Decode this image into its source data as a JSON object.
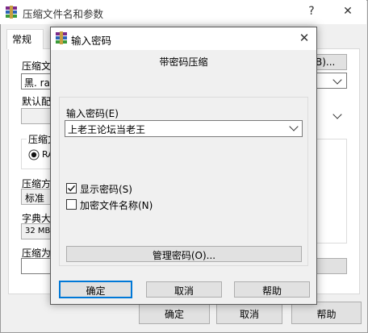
{
  "main_window": {
    "title": "压缩文件名和参数",
    "help_glyph": "?",
    "close_glyph": "✕",
    "tab_general": "常规",
    "archive_label_partial": "压缩文",
    "archive_value_partial": "黑. rar",
    "browse_partial": "B)...",
    "default_profile_partial": "默认配",
    "format_label_partial": "压缩文",
    "format_radio_partial": "RA",
    "method_label_partial": "压缩方",
    "method_value": "标准",
    "dict_label_partial": "字典大",
    "dict_value_partial": "32 MB",
    "split_label_partial": "压缩为",
    "ok_label": "确定",
    "cancel_label": "取消",
    "help_label": "帮助"
  },
  "password_dialog": {
    "title": "输入密码",
    "close_glyph": "✕",
    "heading": "带密码压缩",
    "password_label": "输入密码(E)",
    "password_value": "上老王论坛当老王",
    "show_password_label": "显示密码(S)",
    "show_password_checked": true,
    "encrypt_names_label": "加密文件名称(N)",
    "encrypt_names_checked": false,
    "manage_button": "管理密码(O)...",
    "ok_label": "确定",
    "cancel_label": "取消",
    "help_label": "帮助"
  },
  "colors": {
    "default_button_border": "#0078d7",
    "dialog_border": "#5b5b5b",
    "window_bg": "#f0f0f0"
  },
  "icons": [
    "winrar-icon",
    "close-icon",
    "help-icon",
    "chevron-down-icon",
    "check-icon",
    "radio-selected-icon"
  ]
}
